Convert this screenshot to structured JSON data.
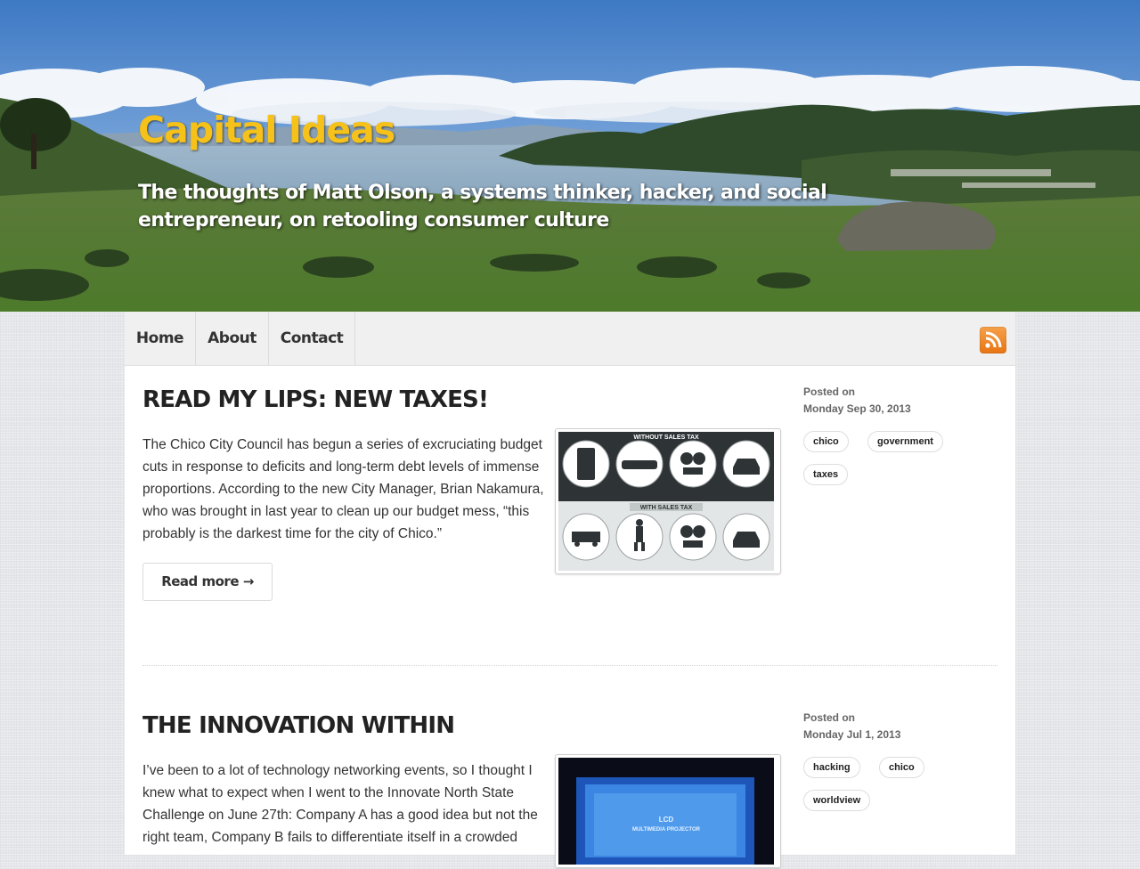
{
  "site": {
    "title": "Capital Ideas",
    "tagline": "The thoughts of Matt Olson, a systems thinker, hacker, and social entrepreneur, on retooling consumer culture"
  },
  "nav": {
    "items": [
      "Home",
      "About",
      "Contact"
    ],
    "rss_icon": "rss-feed-icon"
  },
  "posts": [
    {
      "title": "READ MY LIPS: NEW TAXES!",
      "excerpt": "The Chico City Council has begun a series of excruciating budget cuts in response to deficits and long-term debt levels of immense proportions. According to the new City Manager, Brian Nakamura, who was brought in last year to clean up our budget mess, “this probably is the darkest time for the city of Chico.”",
      "read_more": "Read more →",
      "posted_on_label": "Posted on",
      "date": "Monday Sep 30, 2013",
      "tags": [
        "chico",
        "government",
        "taxes"
      ],
      "image": {
        "heading_top": "WITHOUT SALES TAX",
        "heading_bottom": "WITH SALES TAX"
      }
    },
    {
      "title": "THE INNOVATION WITHIN",
      "excerpt": "I’ve been to a lot of technology networking events, so I thought I knew what to expect when I went to the Innovate North State Challenge on June 27th: Company A has a good idea but not the right team, Company B fails to differentiate itself in a crowded",
      "posted_on_label": "Posted on",
      "date": "Monday Jul 1, 2013",
      "tags": [
        "hacking",
        "chico",
        "worldview"
      ],
      "image": {
        "screen_line1": "LCD",
        "screen_line2": "MULTIMEDIA PROJECTOR"
      }
    }
  ],
  "colors": {
    "title": "#f6c21a",
    "rss": "#e87514",
    "text": "#333333"
  }
}
